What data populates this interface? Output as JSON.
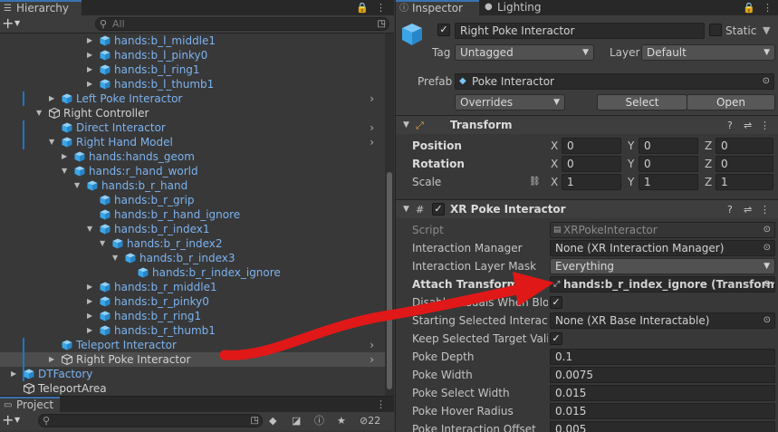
{
  "hierarchy": {
    "tab_label": "Hierarchy",
    "search_placeholder": "All",
    "rows": [
      {
        "label": "hands:b_l_middle1",
        "color": "blue",
        "selected": false
      },
      {
        "label": "hands:b_l_pinky0",
        "color": "blue",
        "selected": false
      },
      {
        "label": "hands:b_l_ring1",
        "color": "blue",
        "selected": false
      },
      {
        "label": "hands:b_l_thumb1",
        "color": "blue",
        "selected": false
      },
      {
        "label": "Left Poke Interactor",
        "color": "blue",
        "selected": false
      },
      {
        "label": "Right Controller",
        "color": "white",
        "selected": false
      },
      {
        "label": "Direct Interactor",
        "color": "blue",
        "selected": false
      },
      {
        "label": "Right Hand Model",
        "color": "blue",
        "selected": false
      },
      {
        "label": "hands:hands_geom",
        "color": "blue",
        "selected": false
      },
      {
        "label": "hands:r_hand_world",
        "color": "blue",
        "selected": false
      },
      {
        "label": "hands:b_r_hand",
        "color": "blue",
        "selected": false
      },
      {
        "label": "hands:b_r_grip",
        "color": "blue",
        "selected": false
      },
      {
        "label": "hands:b_r_hand_ignore",
        "color": "blue",
        "selected": false
      },
      {
        "label": "hands:b_r_index1",
        "color": "blue",
        "selected": false
      },
      {
        "label": "hands:b_r_index2",
        "color": "blue",
        "selected": false
      },
      {
        "label": "hands:b_r_index3",
        "color": "blue",
        "selected": false
      },
      {
        "label": "hands:b_r_index_ignore",
        "color": "blue",
        "selected": false
      },
      {
        "label": "hands:b_r_middle1",
        "color": "blue",
        "selected": false
      },
      {
        "label": "hands:b_r_pinky0",
        "color": "blue",
        "selected": false
      },
      {
        "label": "hands:b_r_ring1",
        "color": "blue",
        "selected": false
      },
      {
        "label": "hands:b_r_thumb1",
        "color": "blue",
        "selected": false
      },
      {
        "label": "Teleport Interactor",
        "color": "blue",
        "selected": false
      },
      {
        "label": "Right Poke Interactor",
        "color": "white",
        "selected": true
      },
      {
        "label": "DTFactory",
        "color": "blue",
        "selected": false
      },
      {
        "label": "TeleportArea",
        "color": "white",
        "selected": false
      }
    ]
  },
  "project": {
    "tab_label": "Project",
    "hidden_count": "22"
  },
  "inspector": {
    "tab_label": "Inspector",
    "lighting_tab_label": "Lighting",
    "object_name": "Right Poke Interactor",
    "static_label": "Static",
    "tag_label": "Tag",
    "tag_value": "Untagged",
    "layer_label": "Layer",
    "layer_value": "Default",
    "prefab_label": "Prefab",
    "prefab_value": "Poke Interactor",
    "overrides_label": "Overrides",
    "select_label": "Select",
    "open_label": "Open",
    "transform": {
      "title": "Transform",
      "position_label": "Position",
      "rotation_label": "Rotation",
      "scale_label": "Scale",
      "x_label": "X",
      "y_label": "Y",
      "z_label": "Z",
      "position": [
        "0",
        "0",
        "0"
      ],
      "rotation": [
        "0",
        "0",
        "0"
      ],
      "scale": [
        "1",
        "1",
        "1"
      ]
    },
    "poke": {
      "title": "XR Poke Interactor",
      "fields": [
        {
          "label": "Script",
          "value": "XRPokeInteractor",
          "bold": false,
          "dim": true
        },
        {
          "label": "Interaction Manager",
          "value": "None (XR Interaction Manager)",
          "bold": false
        },
        {
          "label": "Interaction Layer Mask",
          "value": "Everything",
          "bold": false
        },
        {
          "label": "Attach Transform",
          "value": "hands:b_r_index_ignore (Transform)",
          "bold": true
        },
        {
          "label": "Disable Visuals When Bloc",
          "value": "",
          "bold": false
        },
        {
          "label": "Starting Selected Interacta",
          "value": "None (XR Base Interactable)",
          "bold": false
        },
        {
          "label": "Keep Selected Target Valic",
          "value": "",
          "bold": false
        },
        {
          "label": "Poke Depth",
          "value": "0.1",
          "bold": false
        },
        {
          "label": "Poke Width",
          "value": "0.0075",
          "bold": false
        },
        {
          "label": "Poke Select Width",
          "value": "0.015",
          "bold": false
        },
        {
          "label": "Poke Hover Radius",
          "value": "0.015",
          "bold": false
        },
        {
          "label": "Poke Interaction Offset",
          "value": "0.005",
          "bold": false
        }
      ]
    }
  },
  "colors": {
    "accent_blue": "#7cb3f0",
    "annotation_red": "#e01818",
    "cube_blue": "#3aa6e8"
  }
}
